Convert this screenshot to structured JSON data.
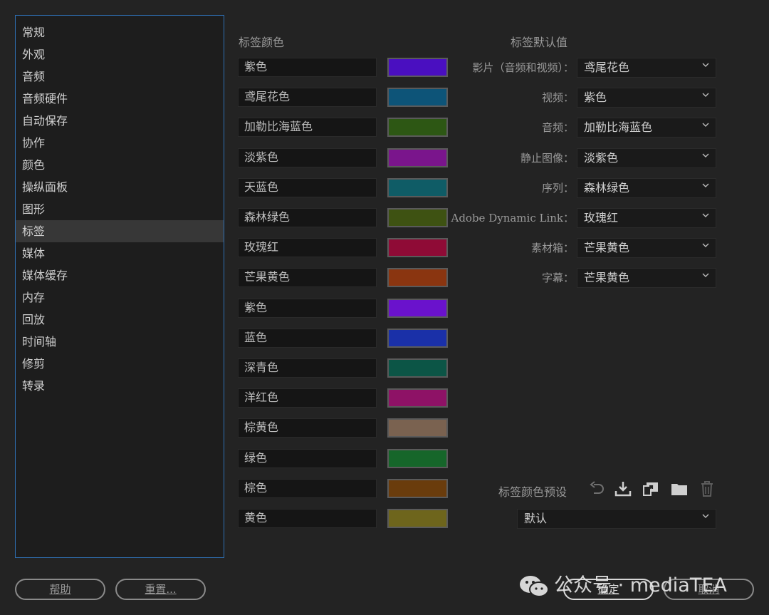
{
  "sidebar": {
    "items": [
      {
        "label": "常规"
      },
      {
        "label": "外观"
      },
      {
        "label": "音频"
      },
      {
        "label": "音频硬件"
      },
      {
        "label": "自动保存"
      },
      {
        "label": "协作"
      },
      {
        "label": "颜色"
      },
      {
        "label": "操纵面板"
      },
      {
        "label": "图形"
      },
      {
        "label": "标签"
      },
      {
        "label": "媒体"
      },
      {
        "label": "媒体缓存"
      },
      {
        "label": "内存"
      },
      {
        "label": "回放"
      },
      {
        "label": "时间轴"
      },
      {
        "label": "修剪"
      },
      {
        "label": "转录"
      }
    ],
    "selected": "标签"
  },
  "label_colors": {
    "title": "标签颜色",
    "rows": [
      {
        "name": "紫色",
        "color": "#4a0fc0"
      },
      {
        "name": "鸢尾花色",
        "color": "#0d5478"
      },
      {
        "name": "加勒比海蓝色",
        "color": "#2d5714"
      },
      {
        "name": "淡紫色",
        "color": "#7a158c"
      },
      {
        "name": "天蓝色",
        "color": "#0f5c66"
      },
      {
        "name": "森林绿色",
        "color": "#3e5212"
      },
      {
        "name": "玫瑰红",
        "color": "#8f0b36"
      },
      {
        "name": "芒果黄色",
        "color": "#8a3510"
      },
      {
        "name": "紫色",
        "color": "#6a12cc"
      },
      {
        "name": "蓝色",
        "color": "#1a30a8"
      },
      {
        "name": "深青色",
        "color": "#0c5546"
      },
      {
        "name": "洋红色",
        "color": "#8e1266"
      },
      {
        "name": "棕黄色",
        "color": "#7a6250"
      },
      {
        "name": "绿色",
        "color": "#16662a"
      },
      {
        "name": "棕色",
        "color": "#6a3c0c"
      },
      {
        "name": "黄色",
        "color": "#6e651c"
      }
    ]
  },
  "label_defaults": {
    "title": "标签默认值",
    "rows": [
      {
        "label": "影片（音频和视频）：",
        "value": "鸢尾花色"
      },
      {
        "label": "视频：",
        "value": "紫色"
      },
      {
        "label": "音频：",
        "value": "加勒比海蓝色"
      },
      {
        "label": "静止图像：",
        "value": "淡紫色"
      },
      {
        "label": "序列：",
        "value": "森林绿色"
      },
      {
        "label": "Adobe Dynamic Link：",
        "value": "玫瑰红"
      },
      {
        "label": "素材箱：",
        "value": "芒果黄色"
      },
      {
        "label": "字幕：",
        "value": "芒果黄色"
      }
    ]
  },
  "preset": {
    "label": "标签颜色预设",
    "value": "默认",
    "icons": [
      "undo-icon",
      "download-icon",
      "import-icon",
      "folder-icon",
      "trash-icon"
    ]
  },
  "buttons": {
    "help": "帮助",
    "reset": "重置...",
    "ok": "确定",
    "cancel": "取消"
  },
  "watermark": {
    "text": "公众号 · mediaTEA"
  },
  "colors": {
    "accent": "#2f6fb2",
    "background": "#232323"
  }
}
